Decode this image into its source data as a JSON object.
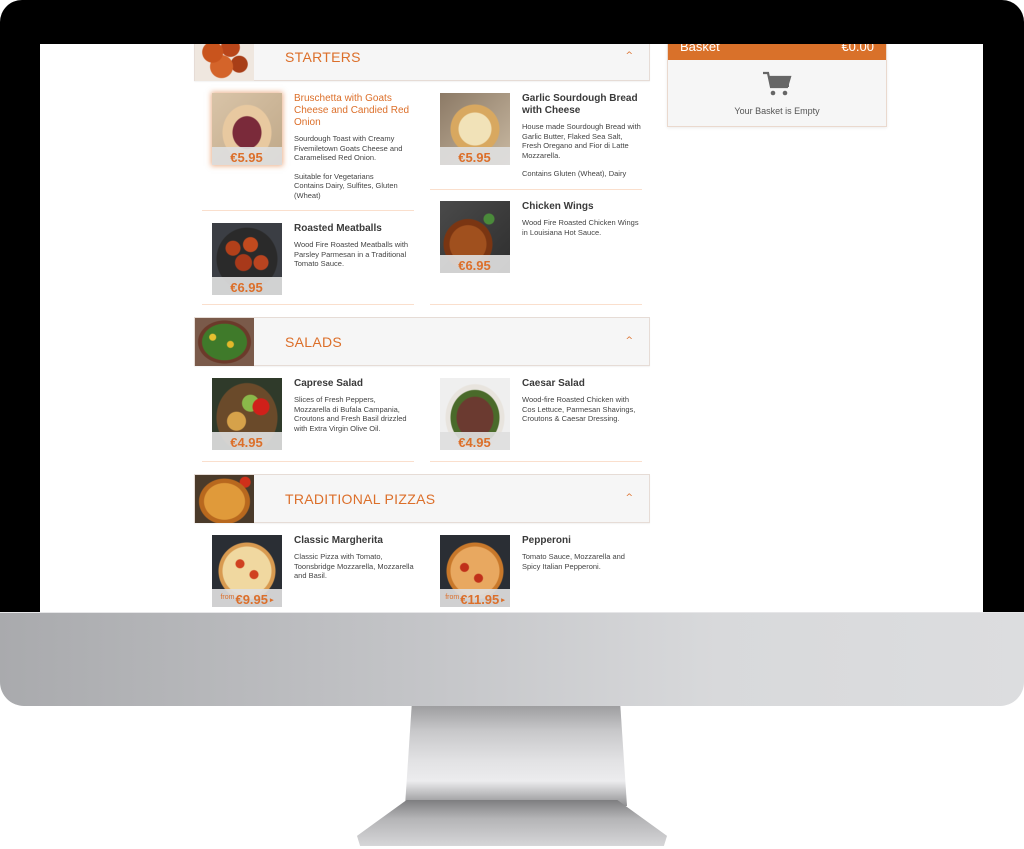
{
  "basket": {
    "title": "Basket",
    "total": "€0.00",
    "empty_message": "Your Basket is Empty",
    "icon": "shopping-cart-icon"
  },
  "colors": {
    "accent": "#dc6f2a",
    "basket_header": "#d9712a",
    "section_bg": "#f6f6f6",
    "divider": "#fadfcd",
    "text": "#3a3a3a"
  },
  "sections": [
    {
      "title": "STARTERS",
      "icon": "chevron-up-icon",
      "chevron": "^",
      "items": [
        {
          "name": "Bruschetta with Goats Cheese and Candied Red Onion",
          "description": "Sourdough Toast with Creamy Fivemiletown Goats Cheese and Caramelised Red Onion.",
          "note": "Suitable for Vegetarians\nContains Dairy, Sulfites, Gluten (Wheat)",
          "price": "€5.95",
          "from": "",
          "arrow": ""
        },
        {
          "name": "Garlic Sourdough Bread with Cheese",
          "description": "House made Sourdough Bread with Garlic Butter, Flaked Sea Salt, Fresh Oregano and Fior di Latte Mozzarella.",
          "note": "Contains Gluten (Wheat), Dairy",
          "price": "€5.95",
          "from": "",
          "arrow": ""
        },
        {
          "name": "Roasted Meatballs",
          "description": "Wood Fire Roasted Meatballs with Parsley Parmesan in a Traditional Tomato Sauce.",
          "note": "",
          "price": "€6.95",
          "from": "",
          "arrow": ""
        },
        {
          "name": "Chicken Wings",
          "description": "Wood Fire Roasted Chicken Wings in Louisiana Hot Sauce.",
          "note": "",
          "price": "€6.95",
          "from": "",
          "arrow": ""
        }
      ]
    },
    {
      "title": "SALADS",
      "icon": "chevron-up-icon",
      "chevron": "^",
      "items": [
        {
          "name": "Caprese Salad",
          "description": "Slices of Fresh Peppers, Mozzarella di Bufala Campania, Croutons and Fresh Basil drizzled with Extra Virgin Olive Oil.",
          "note": "",
          "price": "€4.95",
          "from": "",
          "arrow": ""
        },
        {
          "name": "Caesar Salad",
          "description": "Wood-fire Roasted Chicken with Cos Lettuce, Parmesan Shavings, Croutons & Caesar Dressing.",
          "note": "",
          "price": "€4.95",
          "from": "",
          "arrow": ""
        }
      ]
    },
    {
      "title": "TRADITIONAL PIZZAS",
      "icon": "chevron-up-icon",
      "chevron": "^",
      "items": [
        {
          "name": "Classic Margherita",
          "description": "Classic Pizza with Tomato, Toonsbridge Mozzarella, Mozzarella and Basil.",
          "note": "",
          "price": "€9.95",
          "from": "from",
          "arrow": "▸"
        },
        {
          "name": "Pepperoni",
          "description": "Tomato Sauce, Mozzarella and Spicy Italian Pepperoni.",
          "note": "",
          "price": "€11.95",
          "from": "from",
          "arrow": "▸"
        }
      ]
    }
  ]
}
